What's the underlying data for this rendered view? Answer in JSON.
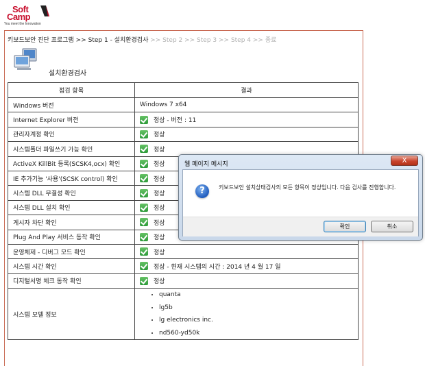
{
  "logo": {
    "soft": "Soft",
    "camp": "Camp",
    "tagline": "You meet the Innovation"
  },
  "breadcrumb": {
    "program": "키보드보안 진단 프로그램",
    "sep": " >> ",
    "current": "Step 1 - 설치환경검사",
    "future": ">> Step 2 >> Step 3 >> Step 4 >> 종료"
  },
  "section_title": "설치환경검사",
  "table": {
    "headers": [
      "점검 항목",
      "결과"
    ],
    "rows": [
      {
        "item": "Windows 버전",
        "result": "Windows 7 x64",
        "ok": false
      },
      {
        "item": "Internet Explorer 버전",
        "result": "정상 - 버전 : 11",
        "ok": true
      },
      {
        "item": "관리자계정 확인",
        "result": "정상",
        "ok": true
      },
      {
        "item": "시스템폴더 파일쓰기 가능 확인",
        "result": "정상",
        "ok": true
      },
      {
        "item": "ActiveX KillBit 등록(SCSK4,ocx) 확인",
        "result": "정상",
        "ok": true
      },
      {
        "item": "IE 추가기능 '사용'(SCSK control) 확인",
        "result": "정상",
        "ok": true
      },
      {
        "item": "시스템 DLL 무결성 확인",
        "result": "정상",
        "ok": true
      },
      {
        "item": "시스템 DLL 설치 확인",
        "result": "정상",
        "ok": true
      },
      {
        "item": "게시자 차단 확인",
        "result": "정상",
        "ok": true
      },
      {
        "item": "Plug And Play 서비스 동작 확인",
        "result": "정상",
        "ok": true
      },
      {
        "item": "운영체제 - 디버그 모드 확인",
        "result": "정상",
        "ok": true
      },
      {
        "item": "시스템 시간 확인",
        "result": "정상 - 현재 시스템의 시간 : 2014 년 4 월 17 일",
        "ok": true
      },
      {
        "item": "디지털서명 체크 동작 확인",
        "result": "정상",
        "ok": true
      }
    ],
    "model_row": {
      "item": "시스템 모델 정보",
      "values": [
        "quanta",
        "lg5b",
        "lg electronics inc.",
        "nd560-yd50k"
      ]
    }
  },
  "dialog": {
    "title": "웹 페이지 메시지",
    "close_label": "X",
    "message": "키보드보안 설치상태검사의 모든 항목이 정상입니다. 다음 검사를 진행합니다.",
    "ok_label": "확인",
    "cancel_label": "취소"
  },
  "colors": {
    "panel_border": "#c96a54",
    "brand_red": "#c8102e",
    "ok_green": "#2e9b3a"
  }
}
